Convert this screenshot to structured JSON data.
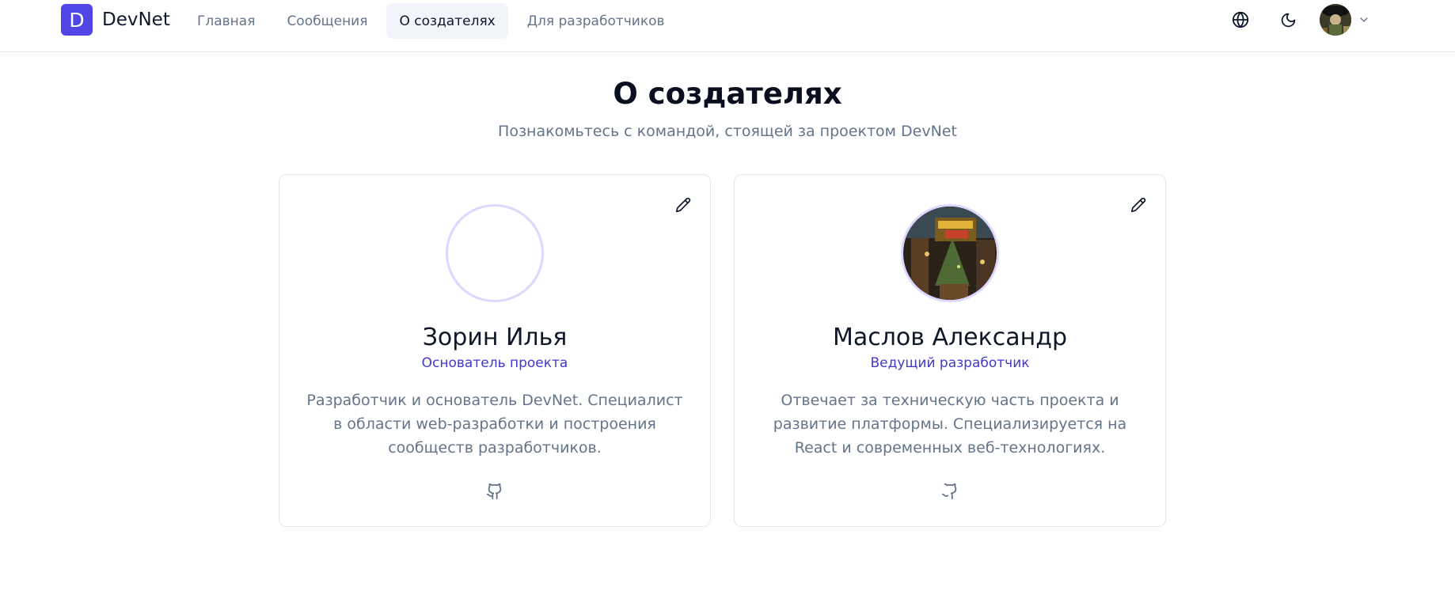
{
  "app": {
    "logo_letter": "D",
    "name": "DevNet"
  },
  "nav": {
    "items": [
      {
        "label": "Главная",
        "active": false
      },
      {
        "label": "Сообщения",
        "active": false
      },
      {
        "label": "О создателях",
        "active": true
      },
      {
        "label": "Для разработчиков",
        "active": false
      }
    ]
  },
  "header_actions": {
    "language_icon": "globe-icon",
    "theme_icon": "moon-icon",
    "user_menu_icon": "chevron-down-icon"
  },
  "page": {
    "title": "О создателях",
    "subtitle": "Познакомьтесь с командой, стоящей за проектом DevNet"
  },
  "creators": [
    {
      "name": "Зорин Илья",
      "role": "Основатель проекта",
      "description": "Разработчик и основатель DevNet. Специалист в области web-разработки и построения сообществ разработчиков.",
      "has_photo": false
    },
    {
      "name": "Маслов Александр",
      "role": "Ведущий разработчик",
      "description": "Отвечает за техническую часть проекта и развитие платформы. Специализируется на React и современных веб-технологиях.",
      "has_photo": true
    }
  ],
  "colors": {
    "brand": "#4f46e5",
    "role_text": "#4338ca",
    "muted_text": "#64748b",
    "avatar_ring": "#ddd6fe"
  }
}
